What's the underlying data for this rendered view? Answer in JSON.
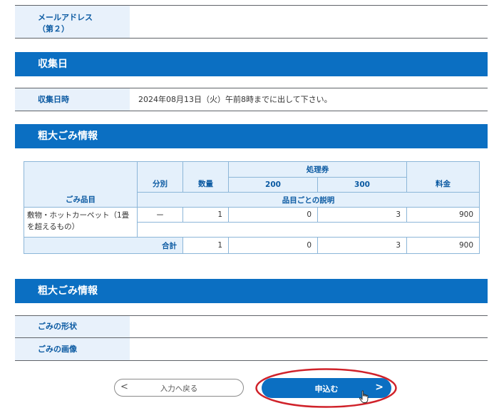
{
  "email2": {
    "label": "メールアドレス\n（第２）",
    "value": ""
  },
  "collection": {
    "header": "収集日",
    "date_label": "収集日時",
    "date_value": "2024年08月13日（火）午前8時までに出して下さい。"
  },
  "items_section": {
    "header": "粗大ごみ情報",
    "table": {
      "col_item": "ごみ品目",
      "col_category": "分別",
      "col_quantity": "数量",
      "col_tickets": "処理券",
      "col_t200": "200",
      "col_t300": "300",
      "col_fee": "料金",
      "col_desc": "品目ごとの説明",
      "rows": [
        {
          "item": "敷物・ホットカーペット（1畳を超えるもの）",
          "category": "ー",
          "quantity": "1",
          "t200": "0",
          "t300": "3",
          "fee": "900",
          "description": ""
        }
      ],
      "total": {
        "label": "合計",
        "quantity": "1",
        "t200": "0",
        "t300": "3",
        "fee": "900"
      }
    }
  },
  "details_section": {
    "header": "粗大ごみ情報",
    "shape_label": "ごみの形状",
    "shape_value": "",
    "image_label": "ごみの画像",
    "image_value": ""
  },
  "buttons": {
    "back_label": "入力へ戻る",
    "back_arrow": "<",
    "apply_label": "申込む",
    "apply_arrow": ">"
  },
  "colors": {
    "header_bg": "#0b6fc2",
    "label_bg": "#e8f1fb",
    "highlight_oval": "#d0222a"
  },
  "icons": [
    "chevron-left-icon",
    "chevron-right-icon",
    "hand-pointer-cursor-icon"
  ]
}
